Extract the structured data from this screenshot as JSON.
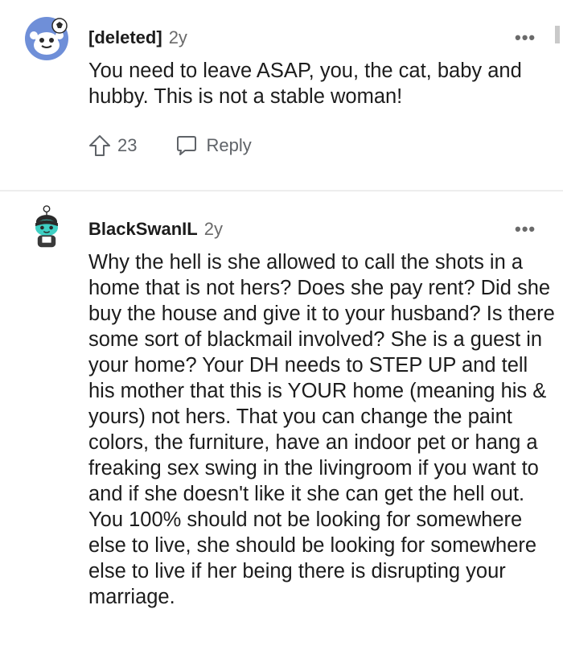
{
  "comments": [
    {
      "author": "[deleted]",
      "time": "2y",
      "more_label": "•••",
      "paragraphs": [
        "You need to leave ASAP, you, the cat, baby and hubby. This is not a stable woman!"
      ],
      "upvotes": "23",
      "reply_label": "Reply",
      "avatar_icon": "snoo-avatar-blue-icon"
    },
    {
      "author": "BlackSwanIL",
      "time": "2y",
      "more_label": "•••",
      "paragraphs": [
        "Why the hell is she allowed to call the shots in a home that is not hers? Does she pay rent? Did she buy the house and give it to your husband? Is there some sort of blackmail involved? She is a guest in your home? Your DH needs to STEP UP and tell his mother that this is YOUR home (meaning his & yours) not hers. That you can change the paint colors, the furniture, have an indoor pet or hang a freaking sex swing in the livingroom if you want to and if she doesn't like it she can get the hell out.",
        "You 100% should not be looking for somewhere else to live, she should be looking for somewhere else to live if her being there is disrupting your marriage."
      ],
      "avatar_icon": "snoo-avatar-teal-icon"
    }
  ],
  "colors": {
    "text": "#1c1c1c",
    "muted": "#6a6a6a",
    "avatar_blue": "#6f8fd8",
    "avatar_teal": "#3fd0c4"
  }
}
